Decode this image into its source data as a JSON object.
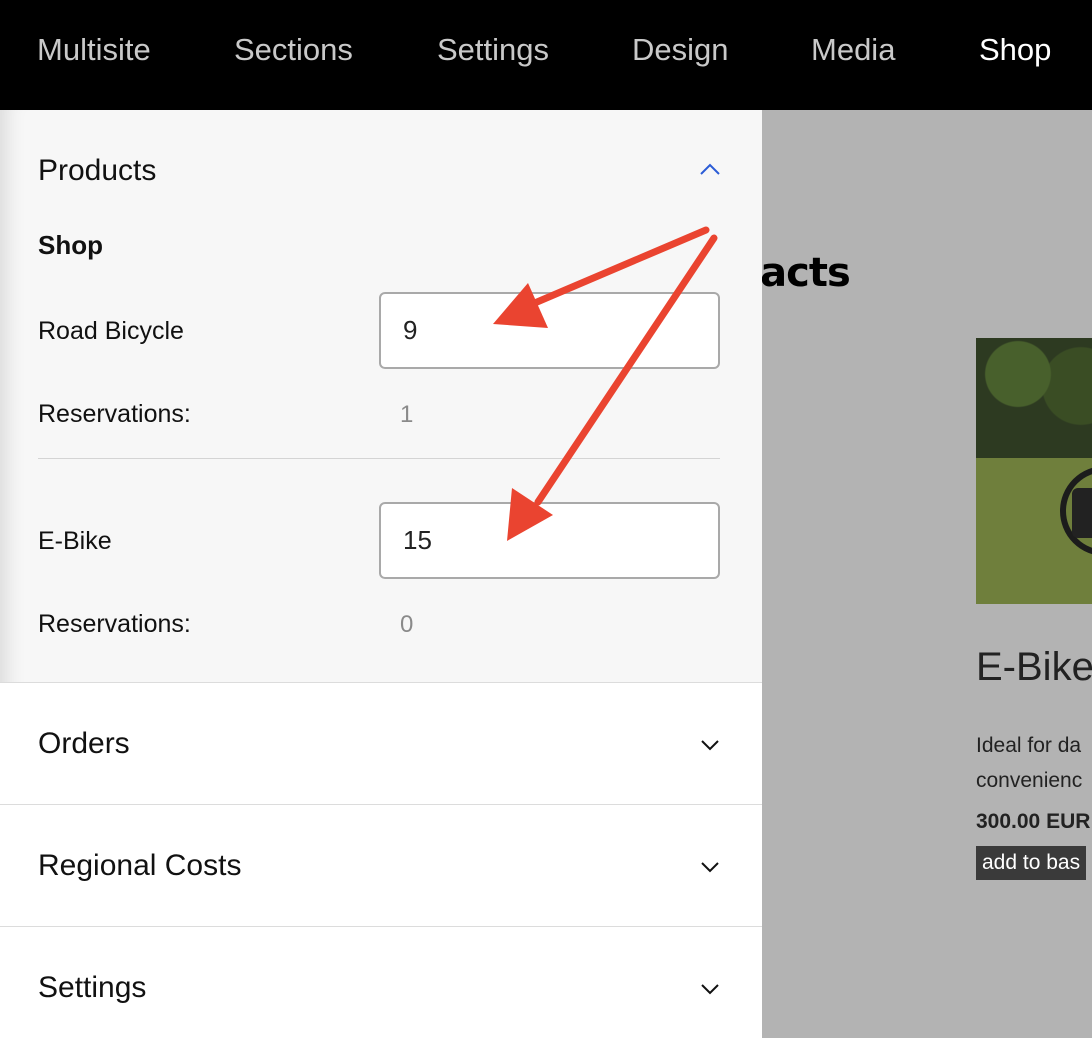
{
  "nav": {
    "items": [
      "Multisite",
      "Sections",
      "Settings",
      "Design",
      "Media",
      "Shop"
    ],
    "active": "Shop"
  },
  "panel": {
    "products": {
      "title": "Products",
      "subheading": "Shop",
      "items": [
        {
          "name": "Road Bicycle",
          "quantity": "9",
          "reservations_label": "Reservations:",
          "reservations": "1"
        },
        {
          "name": "E-Bike",
          "quantity": "15",
          "reservations_label": "Reservations:",
          "reservations": "0"
        }
      ]
    },
    "orders": {
      "title": "Orders"
    },
    "regional_costs": {
      "title": "Regional Costs"
    },
    "settings": {
      "title": "Settings"
    }
  },
  "background_page": {
    "heading_fragment": "tacts",
    "product_title": "E-Bike",
    "description_lines": [
      "Ideal for da",
      "convenienc"
    ],
    "price": "300.00 EUR",
    "basket_button": "add to bas"
  },
  "colors": {
    "nav_bg": "#000000",
    "nav_text": "#c9c9c9",
    "nav_active": "#ffffff",
    "chevron_up": "#2b5cd6",
    "arrow": "#ea4430",
    "overlay_bg": "#b3b3b3"
  },
  "icons": {
    "products_chevron": "chevron-up-icon",
    "collapsed_chevron": "chevron-down-icon"
  }
}
